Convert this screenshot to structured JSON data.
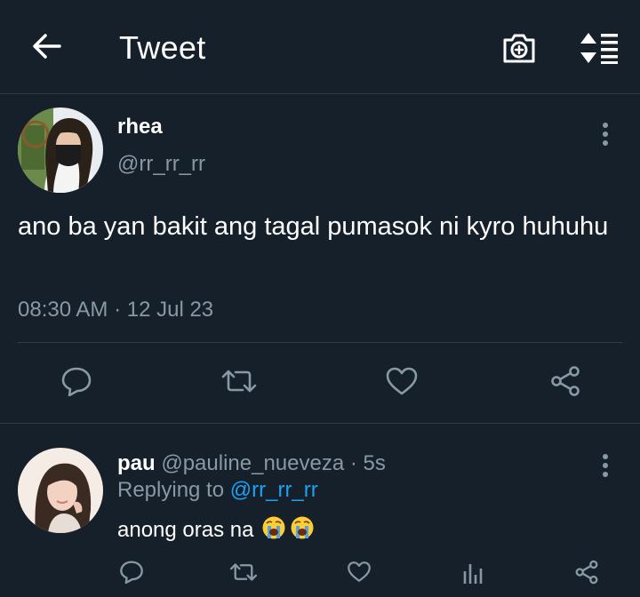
{
  "header": {
    "title": "Tweet",
    "back_icon": "arrow-left-icon",
    "camera_icon": "camera-add-icon",
    "sort_icon": "sort-lines-icon"
  },
  "tweet": {
    "author_name": "rhea",
    "author_handle": "@rr_rr_rr",
    "text": "ano ba yan bakit ang tagal pumasok ni kyro huhuhu",
    "timestamp": "08:30 AM · 12 Jul 23",
    "actions": [
      "reply-icon",
      "retweet-icon",
      "like-icon",
      "share-icon"
    ]
  },
  "reply": {
    "author_name": "pau",
    "author_handle": "@pauline_nueveza",
    "separator": "·",
    "time": "5s",
    "replying_prefix": "Replying to",
    "replying_to": "@rr_rr_rr",
    "text": "anong oras na",
    "emoji": "crying-face-emoji",
    "actions": [
      "reply-icon",
      "retweet-icon",
      "like-icon",
      "analytics-icon",
      "share-icon"
    ]
  },
  "colors": {
    "background": "#15202b",
    "divider": "#2f3c48",
    "secondary_text": "#8899a6",
    "link": "#1da1f2"
  }
}
